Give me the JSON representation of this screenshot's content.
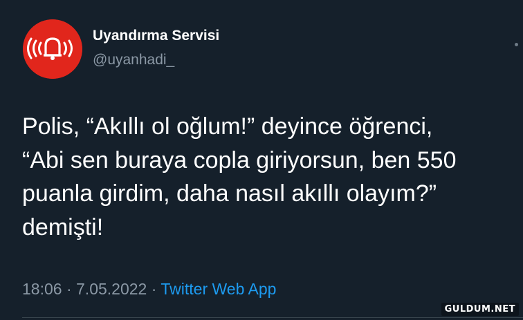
{
  "tweet": {
    "author_name": "Uyandırma Servisi",
    "author_handle": "@uyanhadi_",
    "text_lines": [
      "Polis, “Akıllı ol oğlum!” deyince öğrenci,",
      "“Abi sen buraya copla giriyorsun, ben 550",
      "puanla girdim, daha nasıl akıllı olayım?”",
      "demişti!"
    ],
    "time": "18:06",
    "separator": "·",
    "date": "7.05.2022",
    "source": "Twitter Web App"
  },
  "watermark": "GULDUM.NET",
  "colors": {
    "background": "#15202b",
    "avatar_red": "#e1261c",
    "link_blue": "#1d9bf0",
    "muted": "#8b98a5"
  },
  "icons": {
    "avatar": "alarm-bell-icon"
  }
}
